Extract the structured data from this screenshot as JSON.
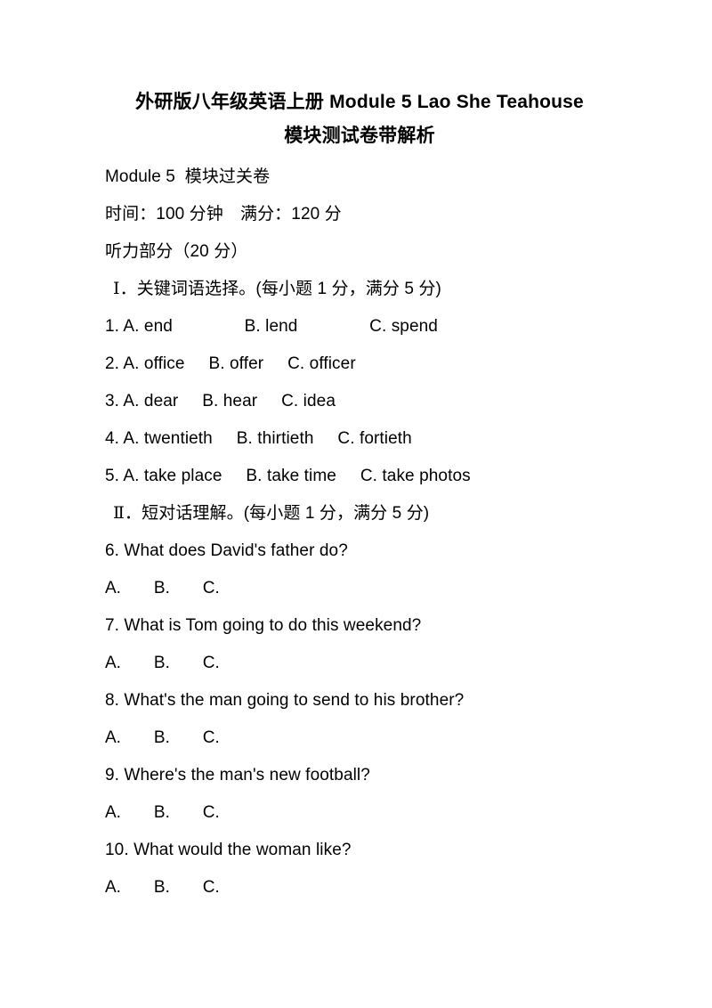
{
  "document": {
    "title_lines": [
      "外研版八年级英语上册 Module 5 Lao She Teahouse",
      "模块测试卷带解析"
    ],
    "module_line": "Module 5  模块过关卷",
    "time_line": "时间：100 分钟　满分：120 分",
    "part_line": "听力部分（20 分）"
  },
  "sections": [
    {
      "heading": "Ⅰ．关键词语选择。(每小题 1 分，满分 5 分)",
      "roman": "Ⅰ",
      "heading_rest": "．关键词语选择。(每小题 1 分，满分 5 分)",
      "items": [
        "1. A. end               B. lend               C. spend",
        "2. A. office     B. offer     C. officer",
        "3. A. dear     B. hear     C. idea",
        "4. A. twentieth     B. thirtieth     C. fortieth",
        "5. A. take place     B. take time     C. take photos"
      ]
    },
    {
      "heading": "Ⅱ．短对话理解。(每小题 1 分，满分 5 分)",
      "roman": "Ⅱ",
      "heading_rest": "．短对话理解。(每小题 1 分，满分 5 分)",
      "questions": [
        {
          "text": "6. What does David's father do?",
          "options": "A.       B.       C."
        },
        {
          "text": "7. What is Tom going to do this weekend?",
          "options": "A.       B.       C."
        },
        {
          "text": "8. What's the man going to send to his brother?",
          "options": "A.       B.       C."
        },
        {
          "text": "9. Where's the man's new football?",
          "options": "A.       B.       C."
        },
        {
          "text": "10. What would the woman like?",
          "options": "A.       B.       C."
        }
      ]
    }
  ]
}
